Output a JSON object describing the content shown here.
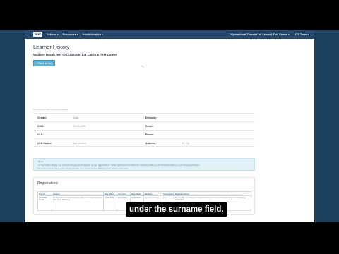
{
  "navbar": {
    "logo": "REPT",
    "items": [
      {
        "label": "Actions"
      },
      {
        "label": "Resources"
      },
      {
        "label": "Administration"
      }
    ],
    "centre_selector": "\"Operational Threads\" at Laura & Tast Centre",
    "user_menu": "CIT Team"
  },
  "header": {
    "title": "Learner History",
    "subtitle": "Wallace Booth test ID (32343087) at Laura & Test Centre",
    "back_button": "Back to list"
  },
  "details": {
    "intro_note": "Here are the student's current details",
    "fields": [
      {
        "label": "Gender:",
        "value": "Male"
      },
      {
        "label": "Ethnicity:",
        "value": ""
      },
      {
        "label": "DOB:",
        "value": "01/01/1999"
      },
      {
        "label": "Email:",
        "value": ""
      },
      {
        "label": "ULN:",
        "value": ""
      },
      {
        "label": "Phone:",
        "value": ""
      },
      {
        "label": "ULN Status:",
        "value": "Not Verified"
      },
      {
        "label": "Address:",
        "value": "XX, Eg"
      }
    ]
  },
  "info_box": {
    "title": "Notes:",
    "line1": "1. The facility shows only courses achievements agreed at your organisation. Other achievements within the awarding body do not show according to your access privileges.",
    "line2": "2. Achievements may not be displayed here for a period of time following their achievement date."
  },
  "registrations": {
    "title": "Registrations",
    "columns": [
      "Reg ID",
      "Course",
      "Reg. Date",
      "Acc Cert",
      "Reg. Date",
      "Method",
      "Assessment Date",
      "Registered For"
    ],
    "rows": [
      [
        "34243987 Details",
        "IGCSE Unit 1 Award in Understanding Assessment Structure Processes (Drawing)",
        "01/01/2023",
        "01/10/2023",
        "01/01/2023",
        "Assessment only",
        "Cert",
        "See IGCSE Unit 1 Award in Understanding Assessment Structure Processes (Drawing) 040003817"
      ]
    ]
  },
  "caption": "under the surname field."
}
